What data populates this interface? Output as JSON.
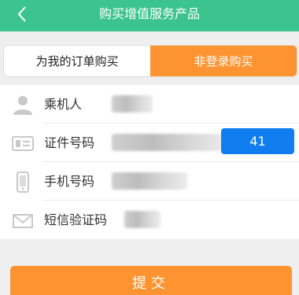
{
  "header": {
    "title": "购买增值服务产品",
    "back_icon": "chevron-left-icon"
  },
  "tabs": [
    {
      "label": "为我的订单购买",
      "active": false
    },
    {
      "label": "非登录购买",
      "active": true
    }
  ],
  "form": {
    "passenger": {
      "label": "乘机人",
      "icon": "person-icon"
    },
    "id_number": {
      "label": "证件号码",
      "icon": "id-card-icon"
    },
    "phone": {
      "label": "手机号码",
      "icon": "mobile-phone-icon"
    },
    "sms_code": {
      "label": "短信验证码",
      "icon": "envelope-icon",
      "button_label": "41"
    }
  },
  "submit": {
    "label": "提交"
  },
  "colors": {
    "header": "#3cc48e",
    "accent": "#fd9431",
    "code_button": "#117ef0"
  }
}
